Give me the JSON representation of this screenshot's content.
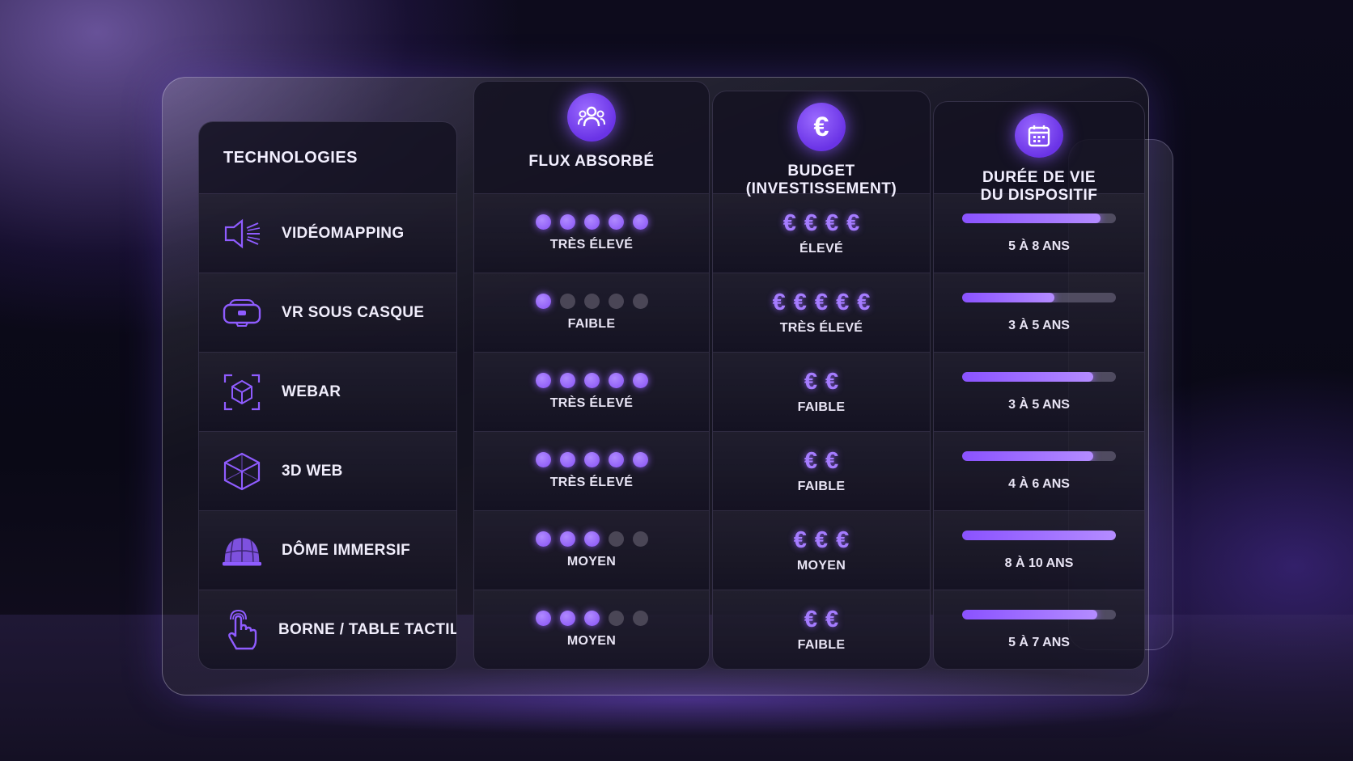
{
  "columns": {
    "technologies": "TECHNOLOGIES",
    "flux": "FLUX ABSORBÉ",
    "budget": "BUDGET\n(INVESTISSEMENT)",
    "duree": "DURÉE DE VIE\nDU DISPOSITIF"
  },
  "header_icons": {
    "flux": "people-icon",
    "budget": "euro-icon",
    "duree": "calendar-icon"
  },
  "accent_color": "#8752f5",
  "rows": [
    {
      "tech": "VIDÉOMAPPING",
      "icon": "projector-icon",
      "flux_dots": 5,
      "flux_label": "TRÈS ÉLEVÉ",
      "euros": 4,
      "budget_label": "ÉLEVÉ",
      "duree_fill": 0.9,
      "duree_label": "5 À 8 ANS"
    },
    {
      "tech": "VR SOUS CASQUE",
      "icon": "vr-headset-icon",
      "flux_dots": 1,
      "flux_label": "FAIBLE",
      "euros": 5,
      "budget_label": "TRÈS ÉLEVÉ",
      "duree_fill": 0.6,
      "duree_label": "3 À 5 ANS"
    },
    {
      "tech": "WEBAR",
      "icon": "ar-cube-icon",
      "flux_dots": 5,
      "flux_label": "TRÈS ÉLEVÉ",
      "euros": 2,
      "budget_label": "FAIBLE",
      "duree_fill": 0.85,
      "duree_label": "3 À 5 ANS"
    },
    {
      "tech": "3D WEB",
      "icon": "3d-cube-icon",
      "flux_dots": 5,
      "flux_label": "TRÈS ÉLEVÉ",
      "euros": 2,
      "budget_label": "FAIBLE",
      "duree_fill": 0.85,
      "duree_label": "4 À 6 ANS"
    },
    {
      "tech": "DÔME IMMERSIF",
      "icon": "dome-icon",
      "flux_dots": 3,
      "flux_label": "MOYEN",
      "euros": 3,
      "budget_label": "MOYEN",
      "duree_fill": 1.0,
      "duree_label": "8 À 10 ANS"
    },
    {
      "tech": "BORNE / TABLE TACTILE",
      "icon": "touch-hand-icon",
      "flux_dots": 3,
      "flux_label": "MOYEN",
      "euros": 2,
      "budget_label": "FAIBLE",
      "duree_fill": 0.88,
      "duree_label": "5 À 7 ANS"
    }
  ]
}
